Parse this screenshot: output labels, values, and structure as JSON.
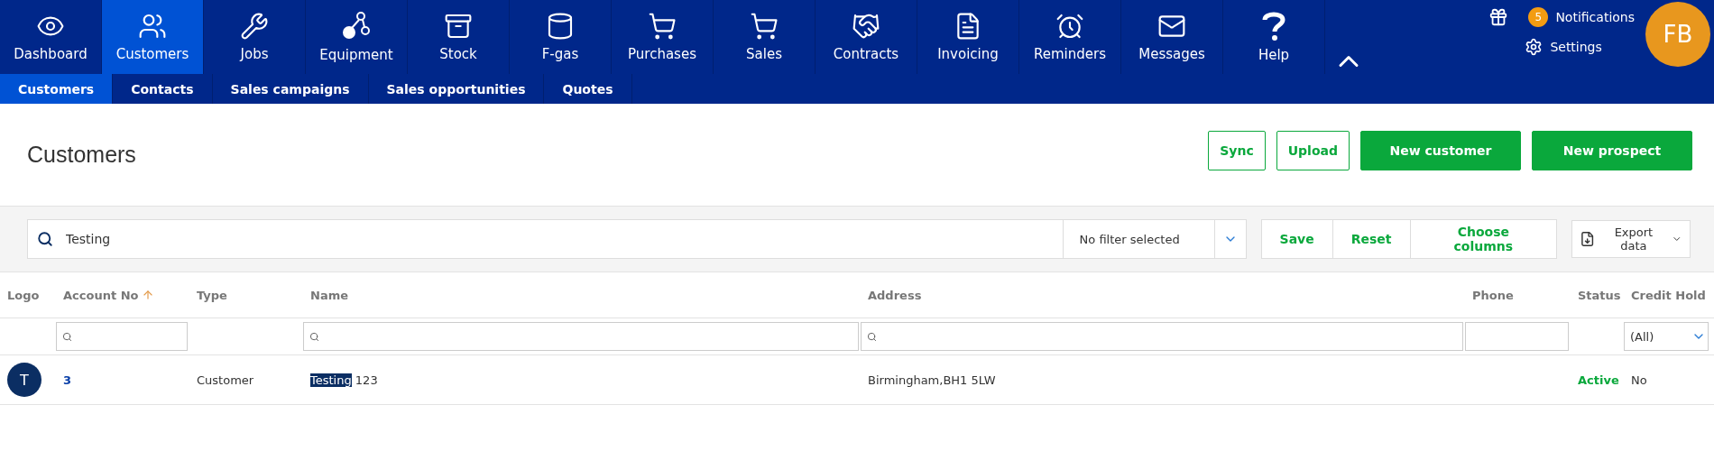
{
  "nav": {
    "items": [
      {
        "label": "Dashboard",
        "selected": false
      },
      {
        "label": "Customers",
        "selected": true
      },
      {
        "label": "Jobs",
        "selected": false
      },
      {
        "label": "Equipment",
        "selected": false
      },
      {
        "label": "Stock",
        "selected": false
      },
      {
        "label": "F-gas",
        "selected": false
      },
      {
        "label": "Purchases",
        "selected": false
      },
      {
        "label": "Sales",
        "selected": false
      },
      {
        "label": "Contracts",
        "selected": false
      },
      {
        "label": "Invoicing",
        "selected": false
      },
      {
        "label": "Reminders",
        "selected": false
      },
      {
        "label": "Messages",
        "selected": false
      },
      {
        "label": "Help",
        "selected": false
      }
    ],
    "notifications": {
      "count": "5",
      "label": "Notifications"
    },
    "settings": "Settings",
    "avatar": "FB"
  },
  "subnav": [
    {
      "label": "Customers",
      "selected": true
    },
    {
      "label": "Contacts",
      "selected": false
    },
    {
      "label": "Sales campaigns",
      "selected": false
    },
    {
      "label": "Sales opportunities",
      "selected": false
    },
    {
      "label": "Quotes",
      "selected": false
    }
  ],
  "page": {
    "title": "Customers",
    "buttons": [
      {
        "label": "Sync",
        "kind": "outline"
      },
      {
        "label": "Upload",
        "kind": "outline"
      },
      {
        "label": "New customer",
        "kind": "solid"
      },
      {
        "label": "New prospect",
        "kind": "solid"
      }
    ]
  },
  "filterbar": {
    "search": "Testing",
    "filter": "No filter selected",
    "actions": [
      "Save",
      "Reset",
      "Choose columns"
    ],
    "export": "Export data"
  },
  "table": {
    "columns": [
      "Logo",
      "Account No",
      "Type",
      "Name",
      "Address",
      "Phone",
      "Status",
      "Credit Hold"
    ],
    "credit_filter": "(All)",
    "rows": [
      {
        "avatar": "T",
        "account": "3",
        "type": "Customer",
        "name_match": "Testing",
        "name_rest": "123",
        "address": "Birmingham,BH1 5LW",
        "phone": "",
        "status": "Active",
        "credit_hold": "No"
      }
    ]
  }
}
